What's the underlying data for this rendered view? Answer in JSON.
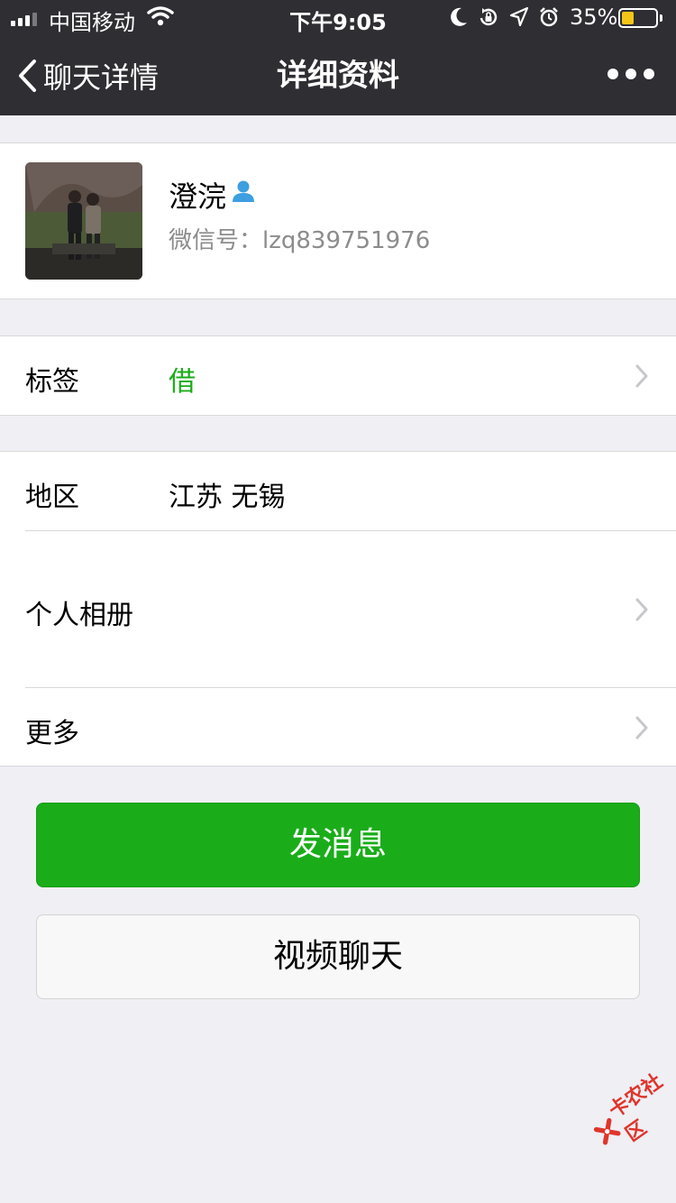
{
  "status_bar": {
    "carrier": "中国移动",
    "time": "下午9:05",
    "battery_percent_label": "35%",
    "battery_level": 0.35
  },
  "nav": {
    "back_label": "聊天详情",
    "title": "详细资料"
  },
  "profile": {
    "name": "澄浣",
    "wechat_id_label": "微信号：",
    "wechat_id": "lzq839751976"
  },
  "tags": {
    "label": "标签",
    "value": "借",
    "value_color": "#1aad19"
  },
  "info": {
    "region_label": "地区",
    "region_value": "江苏 无锡",
    "album_label": "个人相册",
    "more_label": "更多"
  },
  "actions": {
    "send_message": "发消息",
    "video_call": "视频聊天",
    "accent": "#1aad19"
  },
  "watermark": {
    "text": "卡农社区"
  }
}
